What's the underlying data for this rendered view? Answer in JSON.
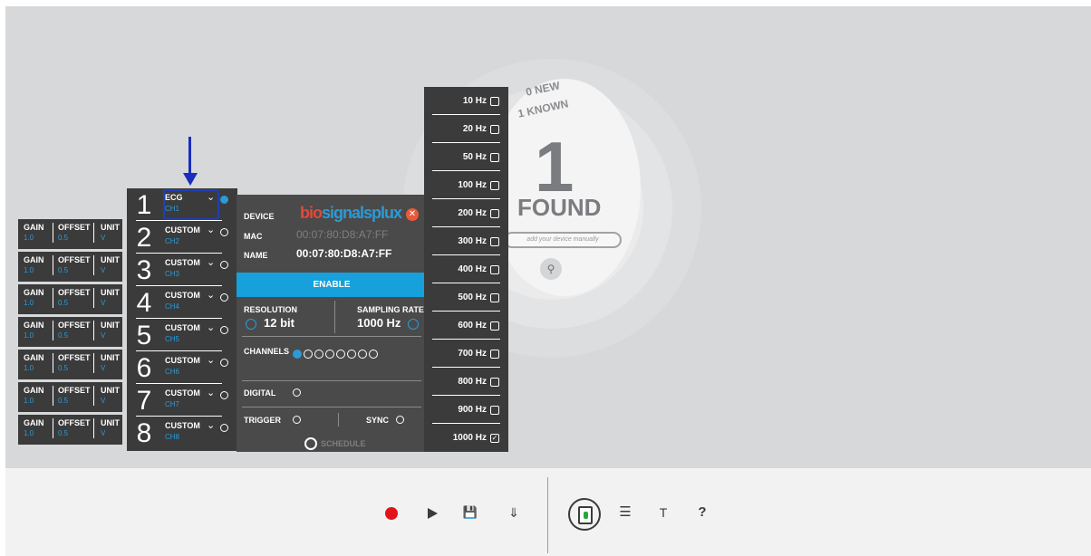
{
  "radar": {
    "new_text": "0 NEW",
    "known_text": "1 KNOWN",
    "found_count": "1",
    "found_label": "FOUND",
    "manual_placeholder": "add your device manually",
    "search_icon": "search-icon"
  },
  "channel_config": {
    "gain_label": "GAIN",
    "offset_label": "OFFSET",
    "unit_label": "UNIT",
    "rows": [
      {
        "gain": "1.0",
        "offset": "0.5",
        "unit": "V"
      },
      {
        "gain": "1.0",
        "offset": "0.5",
        "unit": "V"
      },
      {
        "gain": "1.0",
        "offset": "0.5",
        "unit": "V"
      },
      {
        "gain": "1.0",
        "offset": "0.5",
        "unit": "V"
      },
      {
        "gain": "1.0",
        "offset": "0.5",
        "unit": "V"
      },
      {
        "gain": "1.0",
        "offset": "0.5",
        "unit": "V"
      },
      {
        "gain": "1.0",
        "offset": "0.5",
        "unit": "V"
      }
    ]
  },
  "channels": [
    {
      "num": "1",
      "sensor": "ECG",
      "ch": "CH1",
      "active": true
    },
    {
      "num": "2",
      "sensor": "CUSTOM",
      "ch": "CH2",
      "active": false
    },
    {
      "num": "3",
      "sensor": "CUSTOM",
      "ch": "CH3",
      "active": false
    },
    {
      "num": "4",
      "sensor": "CUSTOM",
      "ch": "CH4",
      "active": false
    },
    {
      "num": "5",
      "sensor": "CUSTOM",
      "ch": "CH5",
      "active": false
    },
    {
      "num": "6",
      "sensor": "CUSTOM",
      "ch": "CH6",
      "active": false
    },
    {
      "num": "7",
      "sensor": "CUSTOM",
      "ch": "CH7",
      "active": false
    },
    {
      "num": "8",
      "sensor": "CUSTOM",
      "ch": "CH8",
      "active": false
    }
  ],
  "device": {
    "device_label": "DEVICE",
    "logo_text_a": "bio",
    "logo_text_b": "signalsplux",
    "mac_label": "MAC",
    "mac_value": "00:07:80:D8:A7:FF",
    "name_label": "NAME",
    "name_value": "00:07:80:D8:A7:FF",
    "enable_label": "ENABLE",
    "resolution_label": "RESOLUTION",
    "resolution_value": "12 bit",
    "sampling_label": "SAMPLING RATE",
    "sampling_value": "1000 Hz",
    "channels_label": "CHANNELS",
    "digital_label": "DIGITAL",
    "trigger_label": "TRIGGER",
    "sync_label": "SYNC",
    "schedule_label": "SCHEDULE",
    "close_icon": "close-icon"
  },
  "frequencies": [
    {
      "label": "10 Hz",
      "checked": false
    },
    {
      "label": "20 Hz",
      "checked": false
    },
    {
      "label": "50 Hz",
      "checked": false
    },
    {
      "label": "100 Hz",
      "checked": false
    },
    {
      "label": "200 Hz",
      "checked": false
    },
    {
      "label": "300 Hz",
      "checked": false
    },
    {
      "label": "400 Hz",
      "checked": false
    },
    {
      "label": "500 Hz",
      "checked": false
    },
    {
      "label": "600 Hz",
      "checked": false
    },
    {
      "label": "700 Hz",
      "checked": false
    },
    {
      "label": "800 Hz",
      "checked": false
    },
    {
      "label": "900 Hz",
      "checked": false
    },
    {
      "label": "1000 Hz",
      "checked": true
    }
  ],
  "toolbar": {
    "record_icon": "record-icon",
    "play_icon": "play-icon",
    "save_icon": "save-icon",
    "download_icon": "download-icon",
    "device_icon": "device-icon",
    "settings_icon": "sliders-icon",
    "cart_icon": "cart-icon",
    "help_label": "?"
  },
  "colors": {
    "accent": "#16a0dc",
    "record": "#e0151b",
    "annotation": "#1a2dbd",
    "panel": "#3b3b3b"
  }
}
